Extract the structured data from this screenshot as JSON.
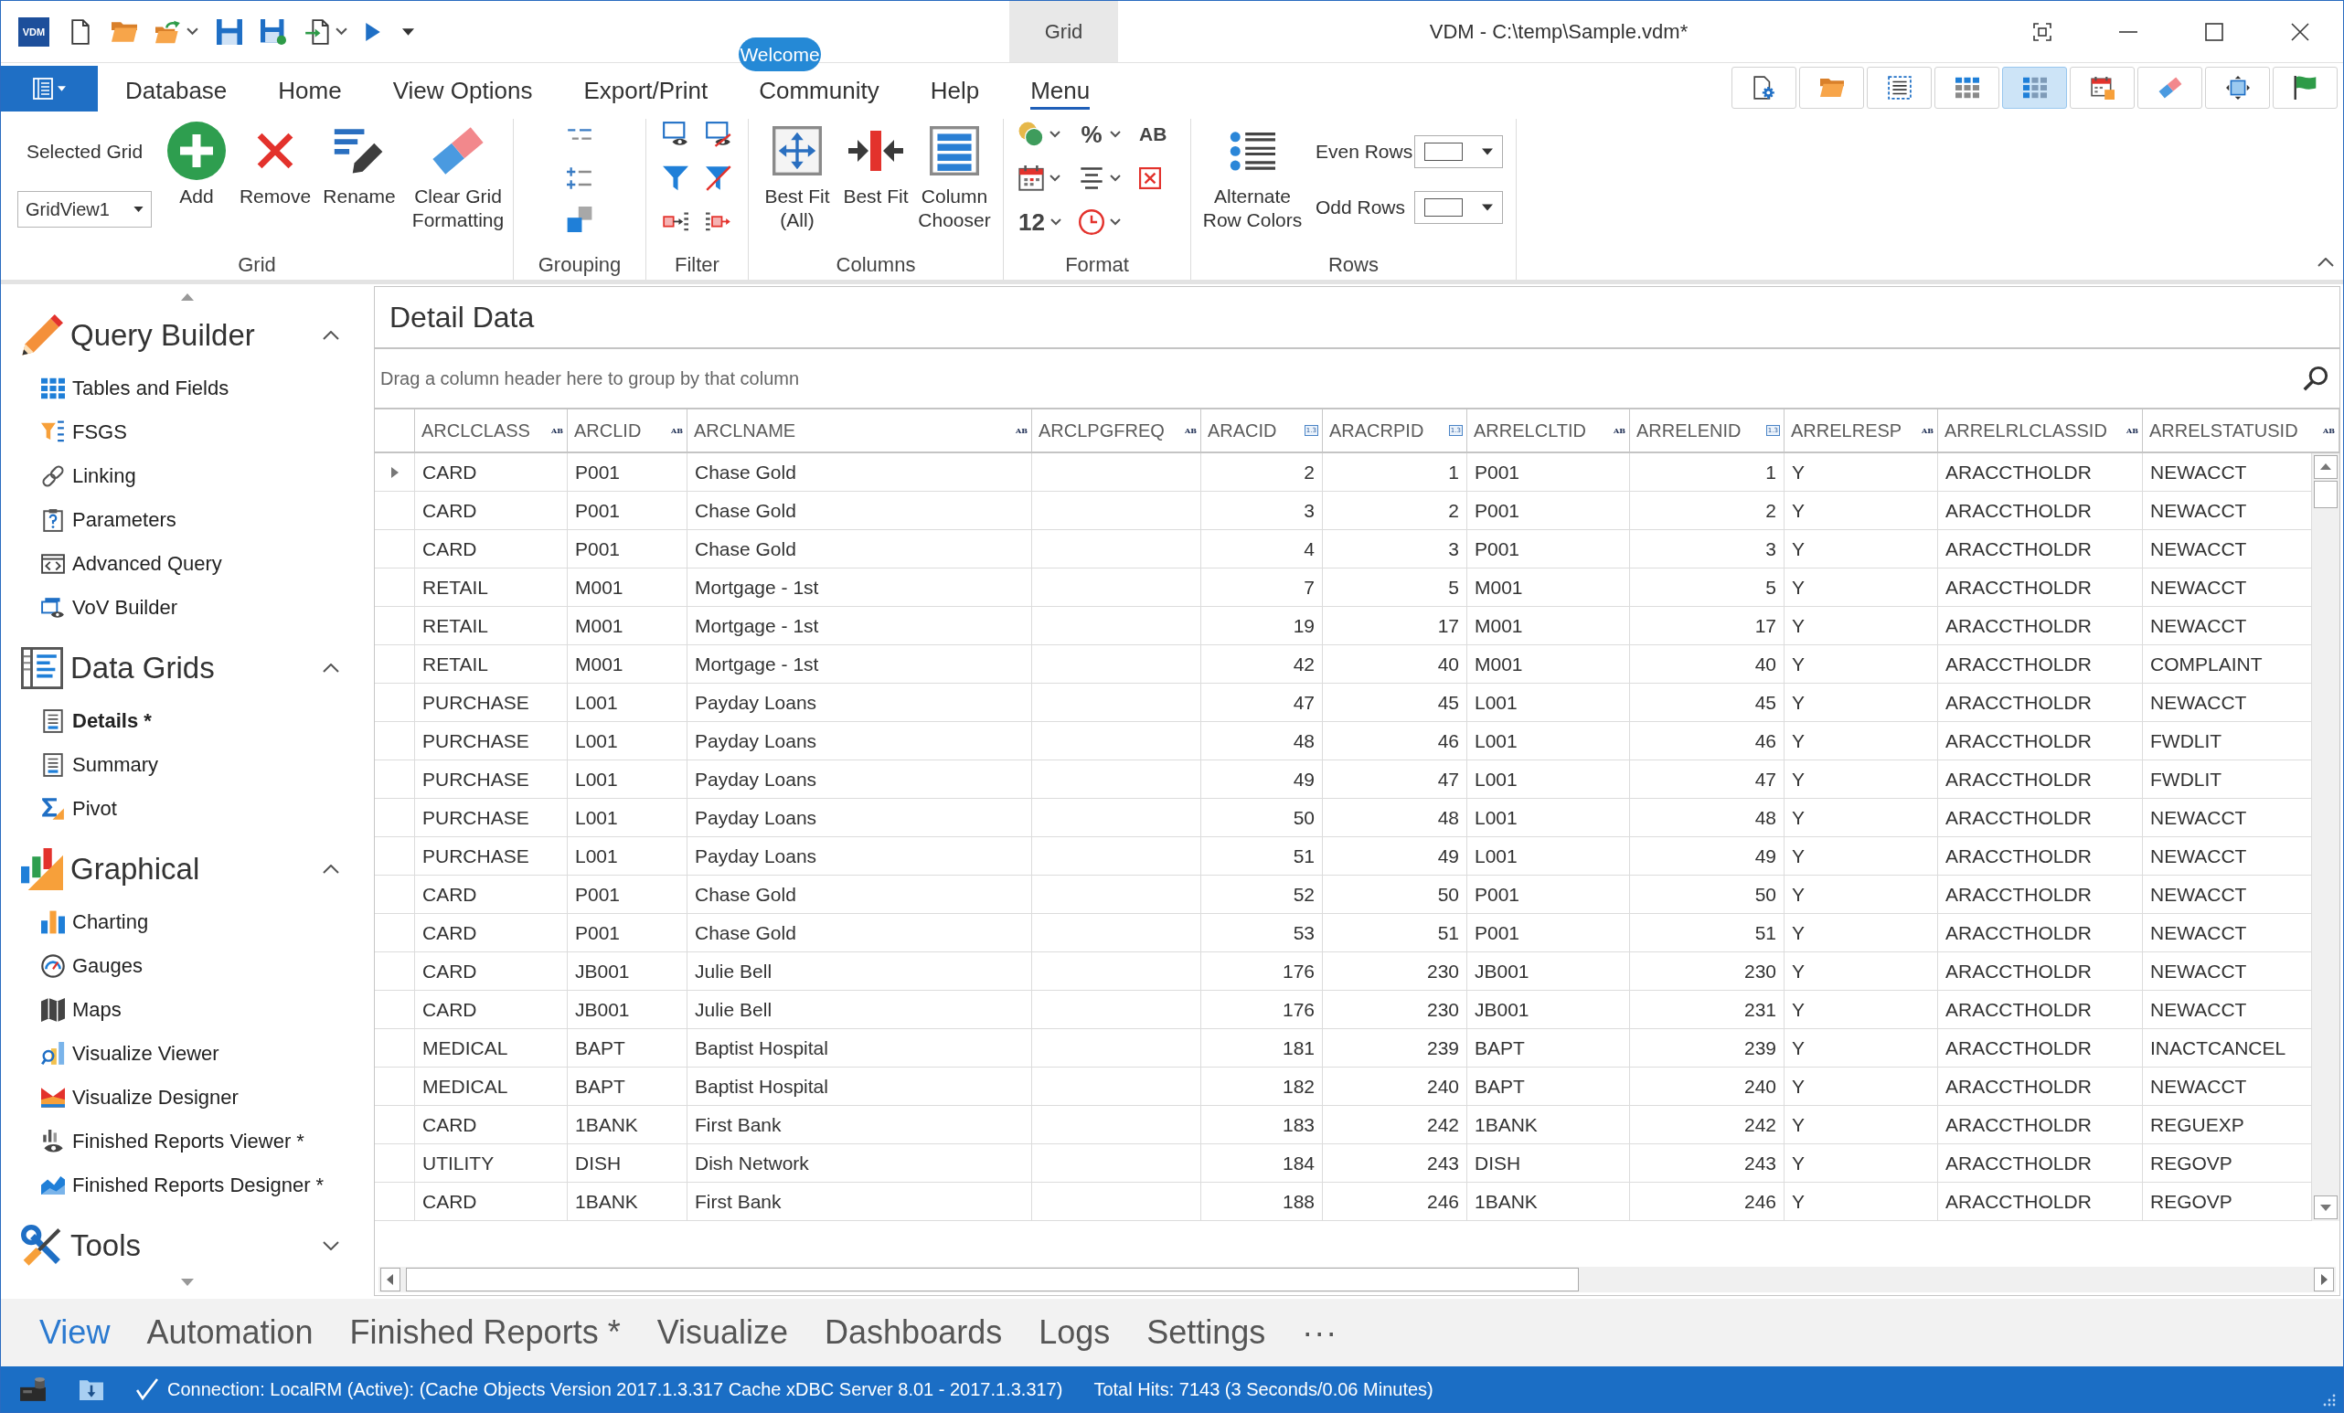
{
  "window": {
    "logo": "VDM",
    "context_tab": "Grid",
    "title": "VDM - C:\\temp\\Sample.vdm*",
    "badge": "Welcome"
  },
  "ribbon": {
    "tabs": [
      {
        "label": "Database",
        "selected": false
      },
      {
        "label": "Home",
        "selected": false
      },
      {
        "label": "View Options",
        "selected": false
      },
      {
        "label": "Export/Print",
        "selected": false
      },
      {
        "label": "Community",
        "selected": false
      },
      {
        "label": "Help",
        "selected": false
      },
      {
        "label": "Menu",
        "selected": true
      }
    ],
    "toolbar": [
      {
        "kind": "page-settings",
        "selected": false
      },
      {
        "kind": "folder",
        "selected": false
      },
      {
        "kind": "dashed-list",
        "selected": false
      },
      {
        "kind": "grid",
        "selected": false
      },
      {
        "kind": "grid-blue",
        "selected": true
      },
      {
        "kind": "calendar",
        "selected": false
      },
      {
        "kind": "eraser",
        "selected": false
      },
      {
        "kind": "fit",
        "selected": false
      },
      {
        "kind": "flag",
        "selected": false
      }
    ],
    "grid_group": {
      "label": "Grid",
      "selector_label": "Selected Grid",
      "selector_value": "GridView1",
      "buttons": [
        {
          "kind": "add",
          "label": "Add"
        },
        {
          "kind": "remove",
          "label": "Remove"
        },
        {
          "kind": "rename",
          "label": "Rename"
        },
        {
          "kind": "clear",
          "label": "Clear Grid Formatting"
        }
      ]
    },
    "grouping_group": {
      "label": "Grouping"
    },
    "filter_group": {
      "label": "Filter"
    },
    "columns_group": {
      "label": "Columns",
      "buttons": [
        {
          "kind": "best-fit-all",
          "label": "Best Fit (All)"
        },
        {
          "kind": "best-fit",
          "label": "Best Fit"
        },
        {
          "kind": "chooser",
          "label": "Column Chooser"
        }
      ]
    },
    "format_group": {
      "label": "Format",
      "percent": "%",
      "text_format": "AB",
      "number_format": "12"
    },
    "rows_group": {
      "label": "Rows",
      "button": "Alternate Row Colors",
      "even_label": "Even Rows",
      "odd_label": "Odd Rows"
    }
  },
  "sidebar": {
    "sections": [
      {
        "kind": "query",
        "title": "Query Builder",
        "expanded": true,
        "items": [
          {
            "kind": "tables",
            "label": "Tables and Fields",
            "selected": false
          },
          {
            "kind": "fsgs",
            "label": "FSGS",
            "selected": false
          },
          {
            "kind": "link",
            "label": "Linking",
            "selected": false
          },
          {
            "kind": "parameters",
            "label": "Parameters",
            "selected": false
          },
          {
            "kind": "code",
            "label": "Advanced Query",
            "selected": false
          },
          {
            "kind": "vov",
            "label": "VoV Builder",
            "selected": false
          }
        ]
      },
      {
        "kind": "grids",
        "title": "Data Grids",
        "expanded": true,
        "items": [
          {
            "kind": "details",
            "label": "Details *",
            "selected": true
          },
          {
            "kind": "summary",
            "label": "Summary",
            "selected": false
          },
          {
            "kind": "pivot",
            "label": "Pivot",
            "selected": false
          }
        ]
      },
      {
        "kind": "graphical",
        "title": "Graphical",
        "expanded": true,
        "items": [
          {
            "kind": "charting",
            "label": "Charting",
            "selected": false
          },
          {
            "kind": "gauges",
            "label": "Gauges",
            "selected": false
          },
          {
            "kind": "maps",
            "label": "Maps",
            "selected": false
          },
          {
            "kind": "viewer",
            "label": "Visualize Viewer",
            "selected": false
          },
          {
            "kind": "designer",
            "label": "Visualize Designer",
            "selected": false
          },
          {
            "kind": "reports-viewer",
            "label": "Finished Reports Viewer *",
            "selected": false
          },
          {
            "kind": "reports-designer",
            "label": "Finished Reports Designer *",
            "selected": false
          }
        ]
      },
      {
        "kind": "tools",
        "title": "Tools",
        "expanded": false
      }
    ]
  },
  "main": {
    "title": "Detail Data",
    "group_hint": "Drag a column header here to group by that column",
    "columns": [
      {
        "name": "ARCLCLASS",
        "kind": "text",
        "badge": "AB"
      },
      {
        "name": "ARCLID",
        "kind": "text",
        "badge": "AB"
      },
      {
        "name": "ARCLNAME",
        "kind": "text",
        "badge": "AB"
      },
      {
        "name": "ARCLPGFREQ",
        "kind": "text",
        "badge": "AB"
      },
      {
        "name": "ARACID",
        "kind": "number",
        "badge": "1.3"
      },
      {
        "name": "ARACRPID",
        "kind": "number",
        "badge": "1.3"
      },
      {
        "name": "ARRELCLTID",
        "kind": "text",
        "badge": "AB"
      },
      {
        "name": "ARRELENID",
        "kind": "number",
        "badge": "1.3"
      },
      {
        "name": "ARRELRESP",
        "kind": "text",
        "badge": "AB"
      },
      {
        "name": "ARRELRLCLASSID",
        "kind": "text",
        "badge": "AB"
      },
      {
        "name": "ARRELSTATUSID",
        "kind": "text",
        "badge": "AB"
      }
    ],
    "rows": [
      {
        "selected": true,
        "cells": [
          "CARD",
          "P001",
          "Chase Gold",
          null,
          "2",
          "1",
          "P001",
          "1",
          "Y",
          "ARACCTHOLDR",
          "NEWACCT"
        ]
      },
      {
        "selected": false,
        "cells": [
          "CARD",
          "P001",
          "Chase Gold",
          null,
          "3",
          "2",
          "P001",
          "2",
          "Y",
          "ARACCTHOLDR",
          "NEWACCT"
        ]
      },
      {
        "selected": false,
        "cells": [
          "CARD",
          "P001",
          "Chase Gold",
          null,
          "4",
          "3",
          "P001",
          "3",
          "Y",
          "ARACCTHOLDR",
          "NEWACCT"
        ]
      },
      {
        "selected": false,
        "cells": [
          "RETAIL",
          "M001",
          "Mortgage - 1st",
          null,
          "7",
          "5",
          "M001",
          "5",
          "Y",
          "ARACCTHOLDR",
          "NEWACCT"
        ]
      },
      {
        "selected": false,
        "cells": [
          "RETAIL",
          "M001",
          "Mortgage - 1st",
          null,
          "19",
          "17",
          "M001",
          "17",
          "Y",
          "ARACCTHOLDR",
          "NEWACCT"
        ]
      },
      {
        "selected": false,
        "cells": [
          "RETAIL",
          "M001",
          "Mortgage - 1st",
          null,
          "42",
          "40",
          "M001",
          "40",
          "Y",
          "ARACCTHOLDR",
          "COMPLAINT"
        ]
      },
      {
        "selected": false,
        "cells": [
          "PURCHASE",
          "L001",
          "Payday Loans",
          null,
          "47",
          "45",
          "L001",
          "45",
          "Y",
          "ARACCTHOLDR",
          "NEWACCT"
        ]
      },
      {
        "selected": false,
        "cells": [
          "PURCHASE",
          "L001",
          "Payday Loans",
          null,
          "48",
          "46",
          "L001",
          "46",
          "Y",
          "ARACCTHOLDR",
          "FWDLIT"
        ]
      },
      {
        "selected": false,
        "cells": [
          "PURCHASE",
          "L001",
          "Payday Loans",
          null,
          "49",
          "47",
          "L001",
          "47",
          "Y",
          "ARACCTHOLDR",
          "FWDLIT"
        ]
      },
      {
        "selected": false,
        "cells": [
          "PURCHASE",
          "L001",
          "Payday Loans",
          null,
          "50",
          "48",
          "L001",
          "48",
          "Y",
          "ARACCTHOLDR",
          "NEWACCT"
        ]
      },
      {
        "selected": false,
        "cells": [
          "PURCHASE",
          "L001",
          "Payday Loans",
          null,
          "51",
          "49",
          "L001",
          "49",
          "Y",
          "ARACCTHOLDR",
          "NEWACCT"
        ]
      },
      {
        "selected": false,
        "cells": [
          "CARD",
          "P001",
          "Chase Gold",
          null,
          "52",
          "50",
          "P001",
          "50",
          "Y",
          "ARACCTHOLDR",
          "NEWACCT"
        ]
      },
      {
        "selected": false,
        "cells": [
          "CARD",
          "P001",
          "Chase Gold",
          null,
          "53",
          "51",
          "P001",
          "51",
          "Y",
          "ARACCTHOLDR",
          "NEWACCT"
        ]
      },
      {
        "selected": false,
        "cells": [
          "CARD",
          "JB001",
          "Julie Bell",
          null,
          "176",
          "230",
          "JB001",
          "230",
          "Y",
          "ARACCTHOLDR",
          "NEWACCT"
        ]
      },
      {
        "selected": false,
        "cells": [
          "CARD",
          "JB001",
          "Julie Bell",
          null,
          "176",
          "230",
          "JB001",
          "231",
          "Y",
          "ARACCTHOLDR",
          "NEWACCT"
        ]
      },
      {
        "selected": false,
        "cells": [
          "MEDICAL",
          "BAPT",
          "Baptist Hospital",
          null,
          "181",
          "239",
          "BAPT",
          "239",
          "Y",
          "ARACCTHOLDR",
          "INACTCANCEL"
        ]
      },
      {
        "selected": false,
        "cells": [
          "MEDICAL",
          "BAPT",
          "Baptist Hospital",
          null,
          "182",
          "240",
          "BAPT",
          "240",
          "Y",
          "ARACCTHOLDR",
          "NEWACCT"
        ]
      },
      {
        "selected": false,
        "cells": [
          "CARD",
          "1BANK",
          "First Bank",
          null,
          "183",
          "242",
          "1BANK",
          "242",
          "Y",
          "ARACCTHOLDR",
          "REGUEXP"
        ]
      },
      {
        "selected": false,
        "cells": [
          "UTILITY",
          "DISH",
          "Dish Network",
          null,
          "184",
          "243",
          "DISH",
          "243",
          "Y",
          "ARACCTHOLDR",
          "REGOVP"
        ]
      },
      {
        "selected": false,
        "cells": [
          "CARD",
          "1BANK",
          "First Bank",
          null,
          "188",
          "246",
          "1BANK",
          "246",
          "Y",
          "ARACCTHOLDR",
          "REGOVP"
        ]
      }
    ]
  },
  "bottom_tabs": {
    "tabs": [
      {
        "label": "View",
        "selected": true
      },
      {
        "label": "Automation",
        "selected": false
      },
      {
        "label": "Finished Reports *",
        "selected": false
      },
      {
        "label": "Visualize",
        "selected": false
      },
      {
        "label": "Dashboards",
        "selected": false
      },
      {
        "label": "Logs",
        "selected": false
      },
      {
        "label": "Settings",
        "selected": false
      }
    ],
    "more": "···"
  },
  "status_bar": {
    "connection": "Connection: LocalRM (Active): (Cache Objects Version 2017.1.3.317 Cache xDBC Server 8.01 - 2017.1.3.317)",
    "hits": "Total Hits: 7143 (3 Seconds/0.06 Minutes)"
  }
}
